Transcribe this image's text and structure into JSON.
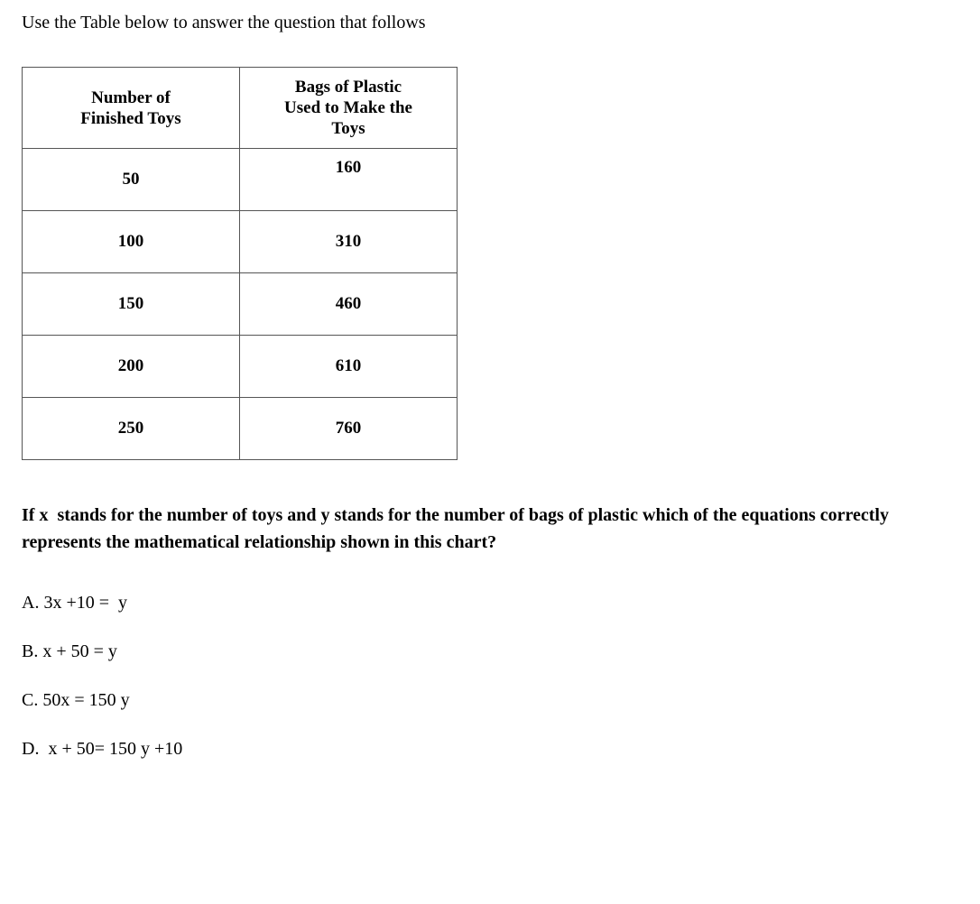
{
  "page": {
    "background_color": "#ffffff",
    "text_color": "#000000"
  },
  "intro": {
    "text": "Use the Table below to answer the question that follows"
  },
  "table": {
    "border_color": "#555555",
    "headers": {
      "col1_lines": [
        "Number of",
        "Finished Toys"
      ],
      "col2_lines": [
        "Bags of Plastic",
        "Used to Make the",
        "Toys"
      ],
      "col1_text": "Number of Finished Toys",
      "col2_text": "Bags of Plastic Used to Make the Toys"
    },
    "rows": [
      {
        "toys": "50",
        "bags": "160"
      },
      {
        "toys": "100",
        "bags": "310"
      },
      {
        "toys": "150",
        "bags": "460"
      },
      {
        "toys": "200",
        "bags": "610"
      },
      {
        "toys": "250",
        "bags": "760"
      }
    ]
  },
  "chart_data": {
    "type": "table",
    "title": "Number of Finished Toys vs Bags of Plastic Used to Make the Toys",
    "columns": [
      "Number of Finished Toys",
      "Bags of Plastic Used to Make the Toys"
    ],
    "x": [
      50,
      100,
      150,
      200,
      250
    ],
    "values": [
      160,
      310,
      460,
      610,
      760
    ],
    "xlabel": "Number of Finished Toys",
    "ylabel": "Bags of Plastic Used to Make the Toys",
    "rows": [
      [
        50,
        160
      ],
      [
        100,
        310
      ],
      [
        150,
        460
      ],
      [
        200,
        610
      ],
      [
        250,
        760
      ]
    ]
  },
  "question": {
    "text": "If x  stands for the number of toys and y stands for the number of bags of plastic which of the equations correctly represents the mathematical relationship shown in this chart?"
  },
  "options": [
    {
      "id": "A",
      "text": "A. 3x +10 =  y"
    },
    {
      "id": "B",
      "text": "B. x + 50 = y"
    },
    {
      "id": "C",
      "text": "C. 50x = 150 y"
    },
    {
      "id": "D",
      "text": "D.  x + 50= 150 y +10"
    }
  ]
}
